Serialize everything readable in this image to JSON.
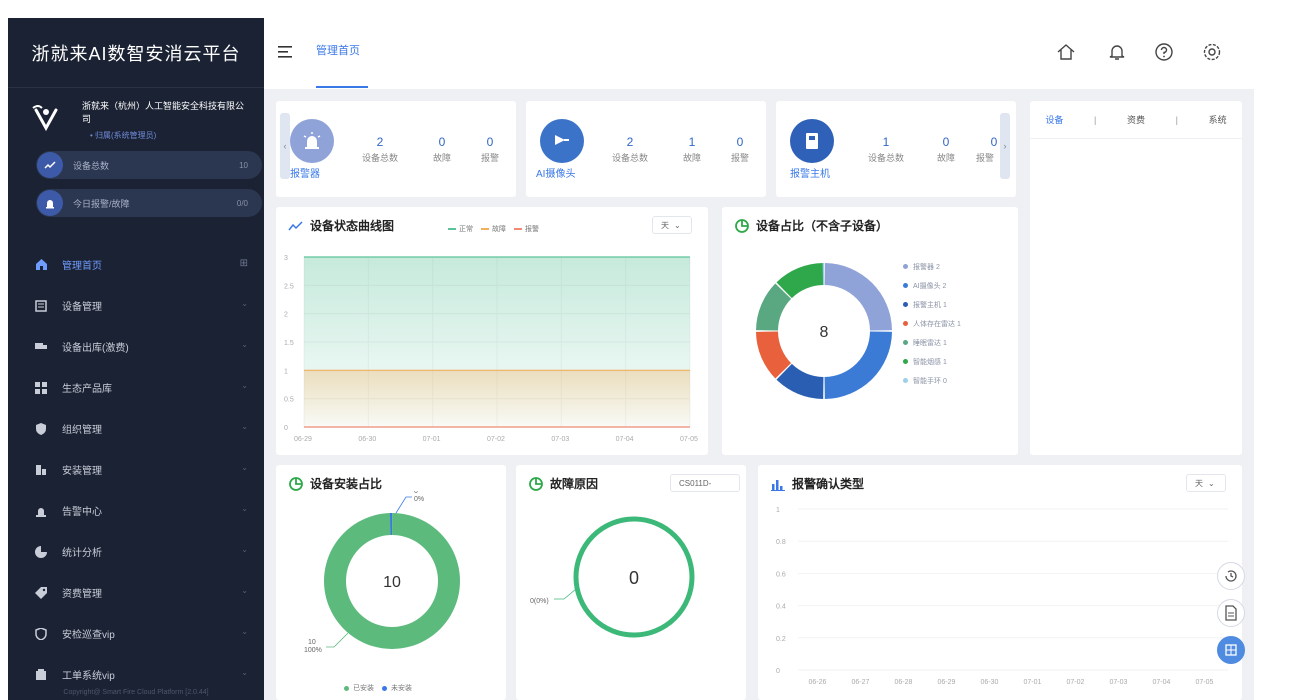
{
  "app": {
    "title": "浙就来AI数智安消云平台"
  },
  "org": {
    "name": "浙就来（杭州）人工智能安全科技有限公司",
    "role": "• 归属(系统管理员)"
  },
  "summary": [
    {
      "label": "设备总数",
      "value": "10"
    },
    {
      "label": "今日报警/故障",
      "value": "0/0"
    }
  ],
  "menu": [
    {
      "label": "管理首页",
      "icon": "home-icon",
      "active": true
    },
    {
      "label": "设备管理",
      "icon": "device-icon"
    },
    {
      "label": "设备出库(激费)",
      "icon": "truck-icon"
    },
    {
      "label": "生态产品库",
      "icon": "grid-icon"
    },
    {
      "label": "组织管理",
      "icon": "org-icon"
    },
    {
      "label": "安装管理",
      "icon": "install-icon"
    },
    {
      "label": "告警中心",
      "icon": "alarm-icon"
    },
    {
      "label": "统计分析",
      "icon": "pie-icon"
    },
    {
      "label": "资费管理",
      "icon": "tag-icon"
    },
    {
      "label": "安检巡查vip",
      "icon": "shield-icon"
    },
    {
      "label": "工单系统vip",
      "icon": "ticket-icon"
    }
  ],
  "copyright": "Copyright@ Smart Fire Cloud Platform [2.0.44]",
  "header": {
    "breadcrumb": "管理首页"
  },
  "stats": [
    {
      "label": "报警器",
      "color": "#8fa3d8",
      "icon": "alarm-light-icon",
      "values": [
        "2",
        "0",
        "0"
      ]
    },
    {
      "label": "AI摄像头",
      "color": "#3b73c9",
      "icon": "camera-icon",
      "values": [
        "2",
        "1",
        "0"
      ]
    },
    {
      "label": "报警主机",
      "color": "#2f61b8",
      "icon": "host-icon",
      "values": [
        "1",
        "0",
        "0"
      ]
    }
  ],
  "stat_captions": [
    "设备总数",
    "故障",
    "报警"
  ],
  "tabs": [
    "设备",
    "资费",
    "系统"
  ],
  "curve_card": {
    "title": "设备状态曲线图",
    "select": "天",
    "legend": [
      {
        "name": "正常",
        "color": "#5cc29a"
      },
      {
        "name": "故障",
        "color": "#f0b060"
      },
      {
        "name": "报警",
        "color": "#ee8b72"
      }
    ]
  },
  "ratio_card": {
    "title": "设备占比（不含子设备）",
    "center": "8"
  },
  "install_card": {
    "title": "设备安装占比",
    "center": "10",
    "label_installed": "10\n100%",
    "label_uninstalled": "0\n0%",
    "legend": [
      "已安装",
      "未安装"
    ]
  },
  "fault_card": {
    "title": "故障原因",
    "select": "CS011D-",
    "center": "0",
    "label": "0(0%)"
  },
  "confirm_card": {
    "title": "报警确认类型",
    "select": "天"
  },
  "chart_data": [
    {
      "type": "area",
      "title": "设备状态曲线图",
      "categories": [
        "06-29",
        "06-30",
        "07-01",
        "07-02",
        "07-03",
        "07-04",
        "07-05"
      ],
      "ylim": [
        0,
        3
      ],
      "yticks": [
        "3",
        "2.5",
        "2",
        "1.5",
        "1",
        "0.5",
        "0"
      ],
      "series": [
        {
          "name": "正常",
          "values": [
            3,
            3,
            3,
            3,
            3,
            3,
            3
          ],
          "color": "#5cc29a"
        },
        {
          "name": "故障",
          "values": [
            1,
            1,
            1,
            1,
            1,
            1,
            1
          ],
          "color": "#f0b060"
        },
        {
          "name": "报警",
          "values": [
            0,
            0,
            0,
            0,
            0,
            0,
            0
          ],
          "color": "#ee8b72"
        }
      ]
    },
    {
      "type": "pie",
      "title": "设备占比（不含子设备）",
      "center": "8",
      "slices": [
        {
          "name": "报警器",
          "value": 2,
          "color": "#8fa3d8",
          "legend": "报警器 2"
        },
        {
          "name": "AI摄像头",
          "value": 2,
          "color": "#3b7bd6",
          "legend": "AI摄像头 2"
        },
        {
          "name": "报警主机",
          "value": 1,
          "color": "#2a5eb3",
          "legend": "报警主机 1"
        },
        {
          "name": "人体存在雷达",
          "value": 1,
          "color": "#e8603c",
          "legend": "人体存在雷达 1"
        },
        {
          "name": "睡眠雷达",
          "value": 1,
          "color": "#5aa882",
          "legend": "睡眠雷达 1"
        },
        {
          "name": "智能烟感",
          "value": 1,
          "color": "#2ea84a",
          "legend": "智能烟感 1"
        },
        {
          "name": "智能手环",
          "value": 0,
          "color": "#9dd0e6",
          "legend": "智能手环 0"
        }
      ]
    },
    {
      "type": "pie",
      "title": "设备安装占比",
      "center": "10",
      "slices": [
        {
          "name": "已安装",
          "value": 10,
          "color": "#5dba7d"
        },
        {
          "name": "未安装",
          "value": 0,
          "color": "#3a78e8"
        }
      ]
    },
    {
      "type": "pie",
      "title": "故障原因",
      "center": "0",
      "slices": [
        {
          "name": "",
          "value": 0,
          "color": "#3cb878"
        }
      ]
    },
    {
      "type": "bar",
      "title": "报警确认类型",
      "categories": [
        "06-26",
        "06-27",
        "06-28",
        "06-29",
        "06-30",
        "07-01",
        "07-02",
        "07-03",
        "07-04",
        "07-05"
      ],
      "ylim": [
        0,
        1
      ],
      "yticks": [
        "1",
        "0.8",
        "0.6",
        "0.4",
        "0.2",
        "0"
      ],
      "values": []
    }
  ]
}
